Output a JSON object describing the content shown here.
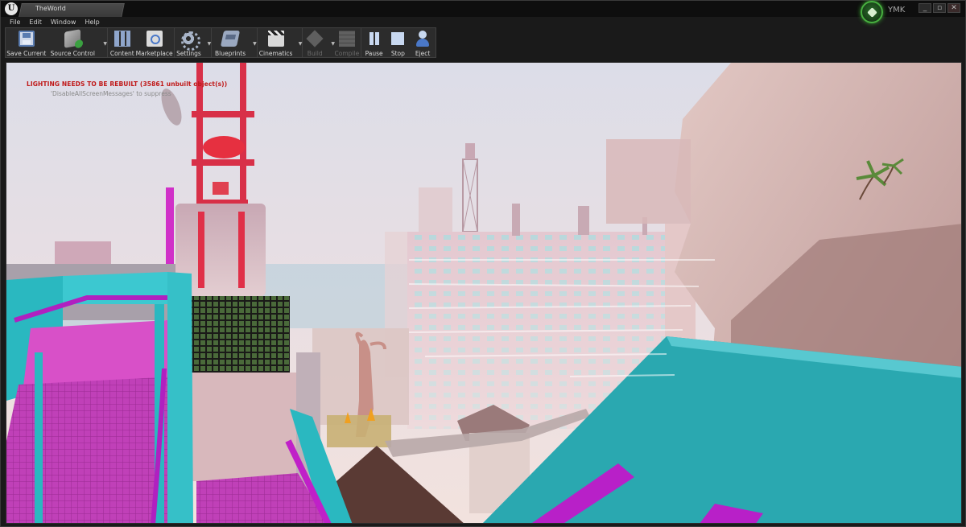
{
  "app": {
    "logo_glyph": "U",
    "tab_title": "TheWorld",
    "profile_name": "YMK",
    "window_buttons": [
      "_",
      "▫",
      "✕"
    ]
  },
  "menu": {
    "items": [
      "File",
      "Edit",
      "Window",
      "Help"
    ]
  },
  "toolbar": {
    "save_current": "Save Current",
    "source_control": "Source Control",
    "content": "Content",
    "marketplace": "Marketplace",
    "settings": "Settings",
    "blueprints": "Blueprints",
    "cinematics": "Cinematics",
    "build": "Build",
    "compile": "Compile",
    "pause": "Pause",
    "stop": "Stop",
    "eject": "Eject",
    "dropdown_glyph": "▼"
  },
  "viewport": {
    "error_message": "LIGHTING NEEDS TO BE REBUILT (35861 unbuilt object(s))",
    "hint_message": "'DisableAllScreenMessages' to suppress"
  },
  "colors": {
    "editor_bg": "#1a1a1a",
    "toolbar_bg": "#2c2c2c",
    "error_red": "#c01818",
    "profile_green": "#48b040",
    "scene_magenta": "#c030c0",
    "scene_cyan": "#2ab0b8",
    "scene_haze": "#e8d8d8"
  },
  "icons": [
    "unreal-logo",
    "save-icon",
    "source-control-icon",
    "content-icon",
    "marketplace-icon",
    "settings-icon",
    "blueprints-icon",
    "cinematics-icon",
    "build-icon",
    "compile-icon",
    "pause-icon",
    "stop-icon",
    "eject-icon",
    "profile-icon"
  ]
}
